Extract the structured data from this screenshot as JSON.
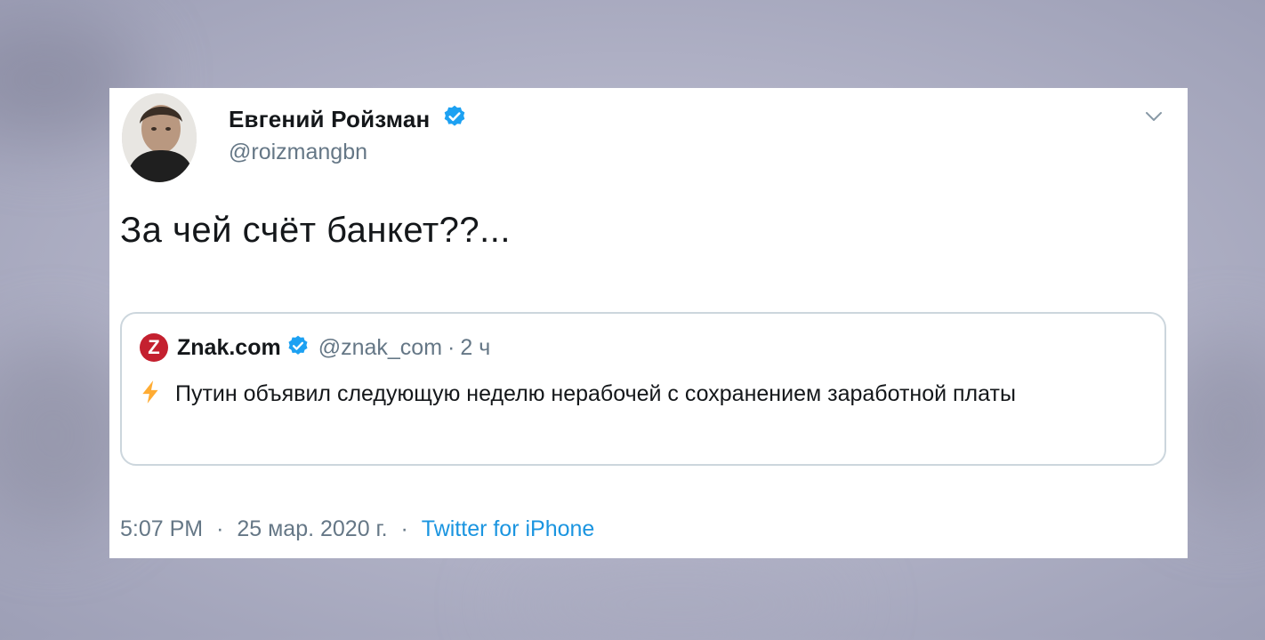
{
  "tweet": {
    "author_name": "Евгений Ройзман",
    "author_handle": "@roizmangbn",
    "text": "За чей счёт банкет??...",
    "time": "5:07 PM",
    "date": "25 мар. 2020 г.",
    "separator": "·",
    "source": "Twitter for iPhone"
  },
  "quoted_tweet": {
    "name": "Znak.com",
    "logo_letter": "Z",
    "handle": "@znak_com",
    "separator": "·",
    "time": "2 ч",
    "text": "Путин объявил следующую неделю нерабочей с сохранением заработной платы"
  },
  "icons": {
    "verified": "verified-badge-icon",
    "caret": "chevron-down-icon",
    "bolt": "lightning-icon"
  },
  "colors": {
    "verified_blue": "#1da1f2",
    "link_blue": "#1b95e0",
    "muted_gray": "#657786",
    "text_dark": "#14171a",
    "quote_border": "#ccd6dd",
    "znak_red": "#c4202f",
    "bolt_yellow": "#ffac33"
  }
}
